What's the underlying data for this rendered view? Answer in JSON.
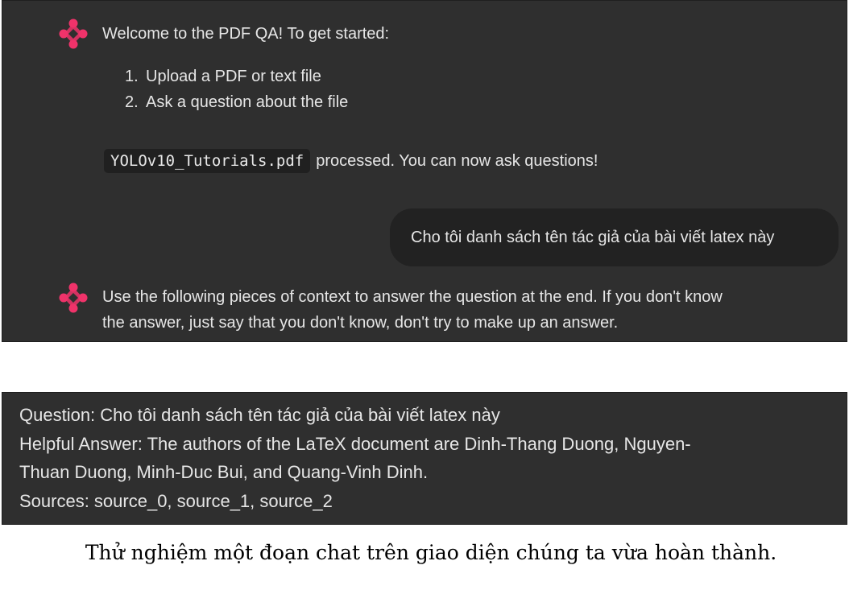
{
  "chat": {
    "welcome": {
      "intro": "Welcome to the PDF QA! To get started:",
      "steps": [
        {
          "num": "1.",
          "text": "Upload a PDF or text file"
        },
        {
          "num": "2.",
          "text": "Ask a question about the file"
        }
      ],
      "file_name": "YOLOv10_Tutorials.pdf",
      "processed_text": "processed. You can now ask questions!"
    },
    "user_message": "Cho tôi danh sách tên tác giả của bài viết latex này",
    "assistant_reply": {
      "line1": "Use the following pieces of context to answer the question at the end. If you don't know",
      "line2": "the answer, just say that you don't know, don't try to make up an answer."
    },
    "answer_output": {
      "question_line": "Question: Cho tôi danh sách tên tác giả của bài viết latex này",
      "answer_line1": "Helpful Answer: The authors of the LaTeX document are Dinh-Thang Duong, Nguyen-",
      "answer_line2": "Thuan Duong, Minh-Duc Bui, and Quang-Vinh Dinh.",
      "sources_line": "Sources: source_0, source_1, source_2"
    }
  },
  "caption": "Thử nghiệm một đoạn chat trên giao diện chúng ta vừa hoàn thành.",
  "colors": {
    "panel_bg": "#2f2f2f",
    "bubble_bg": "#222222",
    "avatar_accent": "#f0336a",
    "text": "#e6e6e6"
  },
  "icons": {
    "assistant_avatar": "assistant-logo-icon"
  }
}
